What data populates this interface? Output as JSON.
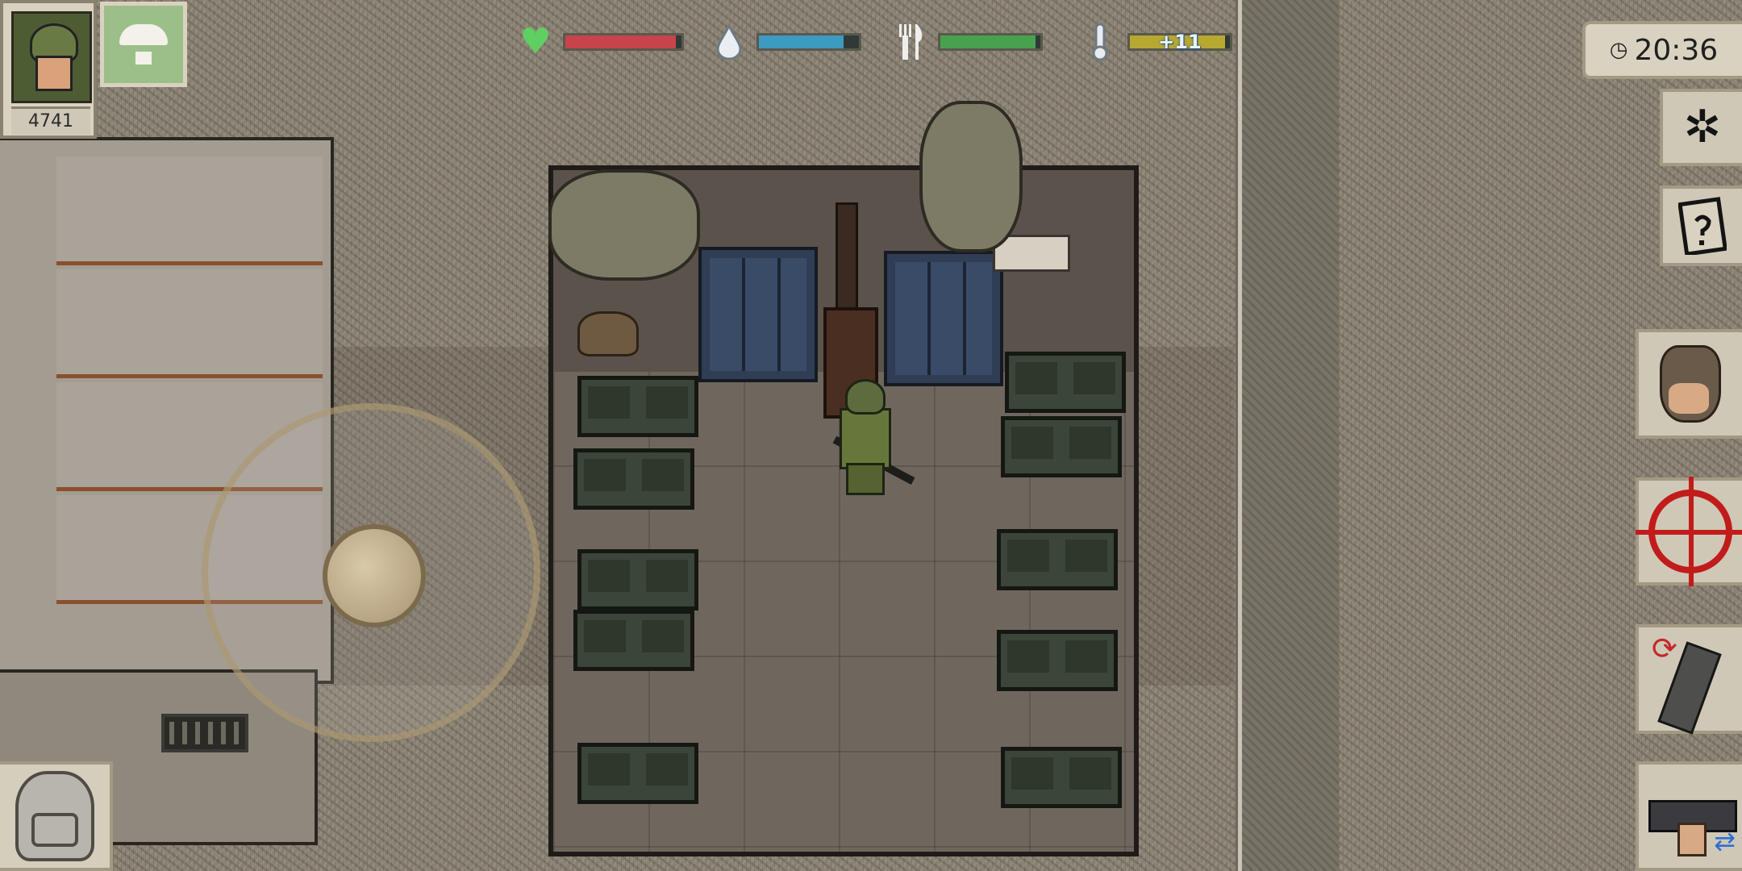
{
  "hud": {
    "player_score": "4741",
    "health": {
      "icon": "heart-icon",
      "level": 0.95,
      "color": "#c9434c"
    },
    "thirst": {
      "icon": "water-drop-icon",
      "level": 0.85,
      "color": "#3d9ac1"
    },
    "hunger": {
      "icon": "fork-knife-icon",
      "level": 0.95,
      "color": "#49a04f"
    },
    "temperature": {
      "icon": "thermometer-icon",
      "level": 0.95,
      "color": "#b7a832",
      "label": "+11"
    },
    "clock": {
      "icon": "clock-icon",
      "time": "20:36"
    }
  },
  "buttons": {
    "settings": "gear-icon",
    "quests": "notepad-icon",
    "interact": "hand-icon",
    "aim": "crosshair-icon",
    "reload": "reload-icon",
    "switch_weapon": "weapon-swap-icon",
    "inventory": "backpack-icon",
    "airdrop": "parachute-icon",
    "joystick": "movement-joystick"
  }
}
